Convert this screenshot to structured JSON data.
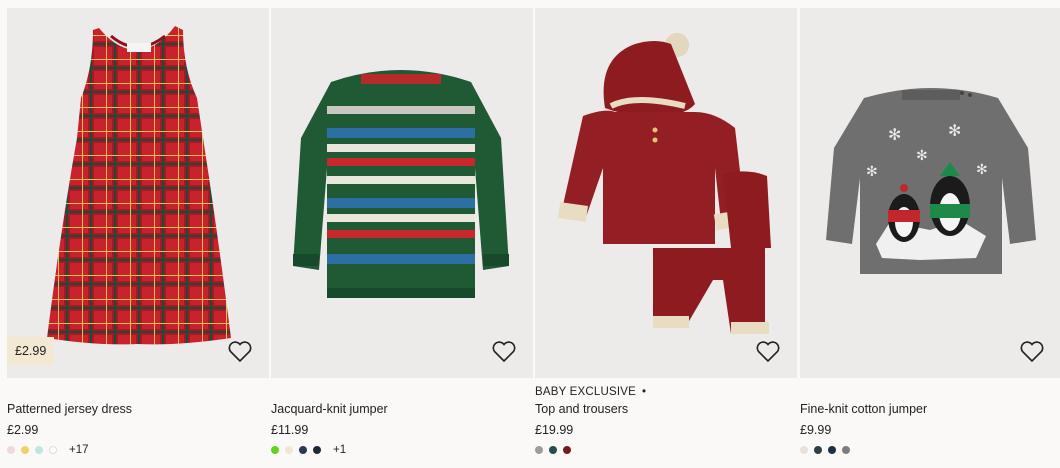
{
  "products": [
    {
      "image_alt": "Patterned jersey dress",
      "price_tag": "£2.99",
      "badge": "",
      "title": "Patterned jersey dress",
      "price": "£2.99",
      "swatches": [
        "#f2d9d9",
        "#f1d16a",
        "#bfe6df",
        "#ffffff"
      ],
      "more": "+17"
    },
    {
      "image_alt": "Jacquard-knit jumper",
      "price_tag": "",
      "badge": "",
      "title": "Jacquard-knit jumper",
      "price": "£11.99",
      "swatches": [
        "#62d21b",
        "#efe6d6",
        "#2b3850",
        "#1e2838"
      ],
      "more": "+1"
    },
    {
      "image_alt": "Top and trousers",
      "price_tag": "",
      "badge": "BABY EXCLUSIVE",
      "badge_dot": "•",
      "title": "Top and trousers",
      "price": "£19.99",
      "swatches": [
        "#9b9e97",
        "#294a4f",
        "#6e1d1f"
      ],
      "more": ""
    },
    {
      "image_alt": "Fine-knit cotton jumper",
      "price_tag": "",
      "badge": "",
      "title": "Fine-knit cotton jumper",
      "price": "£9.99",
      "swatches": [
        "#e6e2dc",
        "#2e4040",
        "#1e2d45",
        "#7d7d7d"
      ],
      "more": ""
    }
  ],
  "icons": {
    "favorite": "heart-outline-icon"
  }
}
